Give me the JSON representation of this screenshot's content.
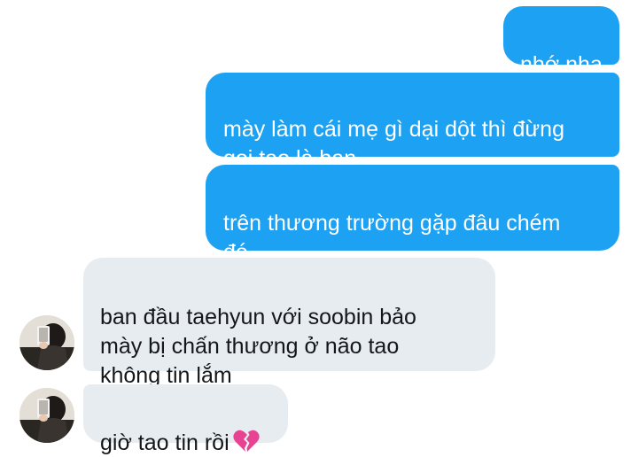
{
  "messages": [
    {
      "id": "m1",
      "direction": "sent",
      "text": "nhớ nha"
    },
    {
      "id": "m2",
      "direction": "sent",
      "text": "mày làm cái mẹ gì dại dột thì đừng\ngọi tao là bạn"
    },
    {
      "id": "m3",
      "direction": "sent",
      "text": "trên thương trường gặp đâu chém\nđó"
    },
    {
      "id": "m4",
      "direction": "received",
      "text": "ban đầu taehyun với soobin bảo\nmày bị chấn thương ở não tao\nkhông tin lắm"
    },
    {
      "id": "m5",
      "direction": "received",
      "text": "giờ tao tin rồi",
      "emoji": "broken-heart-icon"
    }
  ],
  "colors": {
    "sent_bubble": "#1da1f2",
    "sent_text": "#ffffff",
    "received_bubble": "#e6ecf0",
    "received_text": "#14171a",
    "broken_heart": "#e84393"
  }
}
